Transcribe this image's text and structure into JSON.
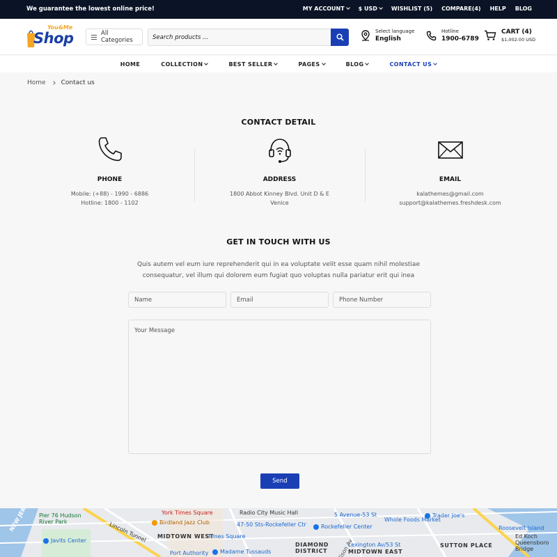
{
  "topbar": {
    "promo": "We guarantee the lowest online price!",
    "links": [
      "MY ACCOUNT",
      "$ USD",
      "WISHLIST (5)",
      "COMPARE(4)",
      "HELP",
      "BLOG"
    ]
  },
  "header": {
    "logo_small": "You&Me",
    "logo_big": "Shop",
    "categories_label": "All Categories",
    "search_placeholder": "Search products ...",
    "language_caption": "Select language",
    "language_value": "English",
    "hotline_caption": "Hotline",
    "hotline_value": "1900-6789",
    "cart_label": "CART (4)",
    "cart_total": "$1,002.00 USD"
  },
  "nav": {
    "items": [
      "HOME",
      "COLLECTION",
      "BEST SELLER",
      "PAGES",
      "BLOG",
      "CONTACT US"
    ]
  },
  "breadcrumb": {
    "home": "Home",
    "current": "Contact us"
  },
  "contact_detail": {
    "heading": "CONTACT DETAIL",
    "phone": {
      "title": "PHONE",
      "lines": [
        "Mobile: (+88) - 1990 - 6886",
        "Hotline: 1800 - 1102"
      ]
    },
    "address": {
      "title": "ADDRESS",
      "lines": [
        "1800 Abbot Kinney Blvd. Unit D & E",
        "Venice"
      ]
    },
    "email": {
      "title": "EMAIL",
      "lines": [
        "kalathemes@gmail.com",
        "support@kalathemes.freshdesk.com"
      ]
    }
  },
  "form": {
    "heading": "GET IN TOUCH WITH US",
    "intro": "Quis autem vel eum iure reprehenderit qui in ea voluptate velit esse quam nihil molestiae consequatur, vel illum qui dolorem eum fugiat quo voluptas nulla pariatur erit qui inea",
    "name_placeholder": "Name",
    "email_placeholder": "Email",
    "phone_placeholder": "Phone Number",
    "message_placeholder": "Your Message",
    "send_label": "Send"
  },
  "map": {
    "labels": [
      "Pier 76 Hudson River Park",
      "Javits Center",
      "York Times Square",
      "Birdland Jazz Club",
      "Lincoln Tunnel",
      "MIDTOWN WEST",
      "Times Square",
      "Port Authority",
      "Madame Tussauds",
      "Radio City Music Hall",
      "47-50 Sts-Rockefeller Ctr",
      "Rockefeller Center",
      "DIAMOND DISTRICT",
      "5 Avenue-53 St",
      "Whole Foods Market",
      "Lexington Av/53 St",
      "MIDTOWN EAST",
      "Trader Joe's",
      "SUTTON PLACE",
      "Roosevelt Island",
      "Ed Koch Queensboro Bridge",
      "NEW JERSEY",
      "Madison Av"
    ]
  },
  "colors": {
    "topbar_bg": "#0b1426",
    "brand_blue": "#1a3fb5",
    "page_bg": "#f7f7f7"
  }
}
